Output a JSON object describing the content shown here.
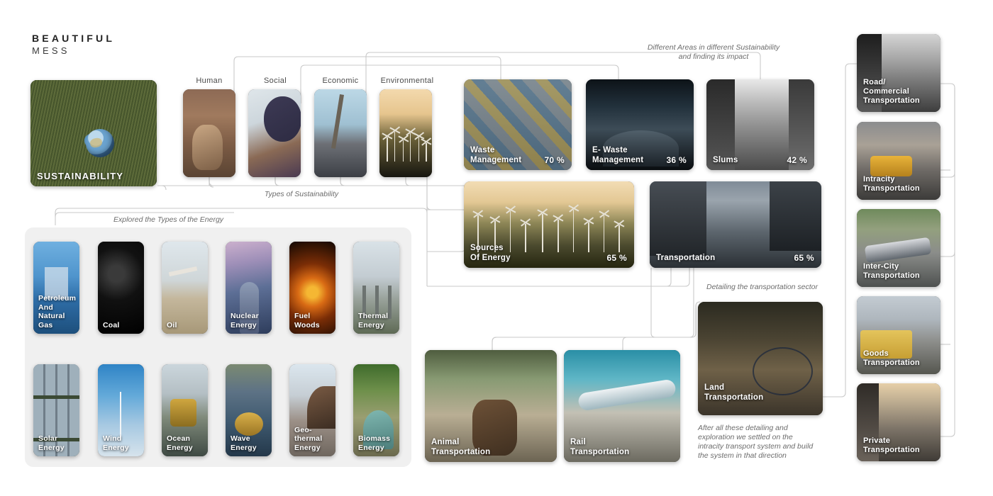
{
  "brand": {
    "line1": "BEAUTIFUL",
    "line2": "MESS"
  },
  "root": {
    "label": "SUSTAINABILITY"
  },
  "types_of_sustainability": {
    "caption": "Types of Sustainability",
    "columns": [
      {
        "title": "Human"
      },
      {
        "title": "Social"
      },
      {
        "title": "Economic"
      },
      {
        "title": "Environmental"
      }
    ]
  },
  "areas": {
    "caption_line1": "Different Areas in different Sustainability",
    "caption_line2": "and finding its impact",
    "cards": [
      {
        "label": "Waste\nManagement",
        "label_l1": "Waste",
        "label_l2": "Management",
        "pct": "70 %"
      },
      {
        "label": "E- Waste Management",
        "label_l1": "E- Waste",
        "label_l2": "Management",
        "pct": "36 %"
      },
      {
        "label": "Slums",
        "label_l1": "Slums",
        "label_l2": "",
        "pct": "42 %"
      }
    ]
  },
  "mid_cards": [
    {
      "label_l1": "Sources",
      "label_l2": "Of Energy",
      "pct": "65 %"
    },
    {
      "label_l1": "Transportation",
      "label_l2": "",
      "pct": "65 %"
    }
  ],
  "energy": {
    "caption": "Explored the Types of the Energy",
    "row1": [
      {
        "l1": "Petroleum",
        "l2": "And",
        "l3": "Natural",
        "l4": "Gas"
      },
      {
        "l1": "Coal",
        "l2": "",
        "l3": "",
        "l4": ""
      },
      {
        "l1": "Oil",
        "l2": "",
        "l3": "",
        "l4": ""
      },
      {
        "l1": "Nuclear",
        "l2": "Energy",
        "l3": "",
        "l4": ""
      },
      {
        "l1": "Fuel",
        "l2": "Woods",
        "l3": "",
        "l4": ""
      },
      {
        "l1": "Thermal",
        "l2": "Energy",
        "l3": "",
        "l4": ""
      }
    ],
    "row2": [
      {
        "l1": "Solar",
        "l2": "Energy"
      },
      {
        "l1": "Wind",
        "l2": "Energy"
      },
      {
        "l1": "Ocean",
        "l2": "Energy"
      },
      {
        "l1": "Wave",
        "l2": "Energy"
      },
      {
        "l1": "Geo-",
        "l2": "thermal",
        "l3": "Energy"
      },
      {
        "l1": "Biomass",
        "l2": "Energy"
      }
    ]
  },
  "transport_detail": {
    "caption": "Detailing the transportation sector",
    "cards": [
      {
        "l1": "Animal",
        "l2": "Transportation"
      },
      {
        "l1": "Rail",
        "l2": "Transportation"
      },
      {
        "l1": "Land",
        "l2": "Transportation"
      }
    ],
    "footnote_l1": "After all these detailing and",
    "footnote_l2": "exploration we settled on the",
    "footnote_l3": "intracity transport system and build",
    "footnote_l4": "the system in that direction"
  },
  "right_column": [
    {
      "l1": "Road/",
      "l2": "Commercial",
      "l3": "Transportation"
    },
    {
      "l1": "Intracity",
      "l2": "Transportation",
      "l3": ""
    },
    {
      "l1": "Inter-City",
      "l2": "Transportation",
      "l3": ""
    },
    {
      "l1": "Goods",
      "l2": "Transportation",
      "l3": ""
    },
    {
      "l1": "Private",
      "l2": "Transportation",
      "l3": ""
    }
  ],
  "colors": {
    "background": "#ffffff",
    "panel": "#f0f0f0",
    "wire": "#c9c9c9",
    "caption_text": "#6c6c6c",
    "title_text": "#4a4a4a"
  }
}
